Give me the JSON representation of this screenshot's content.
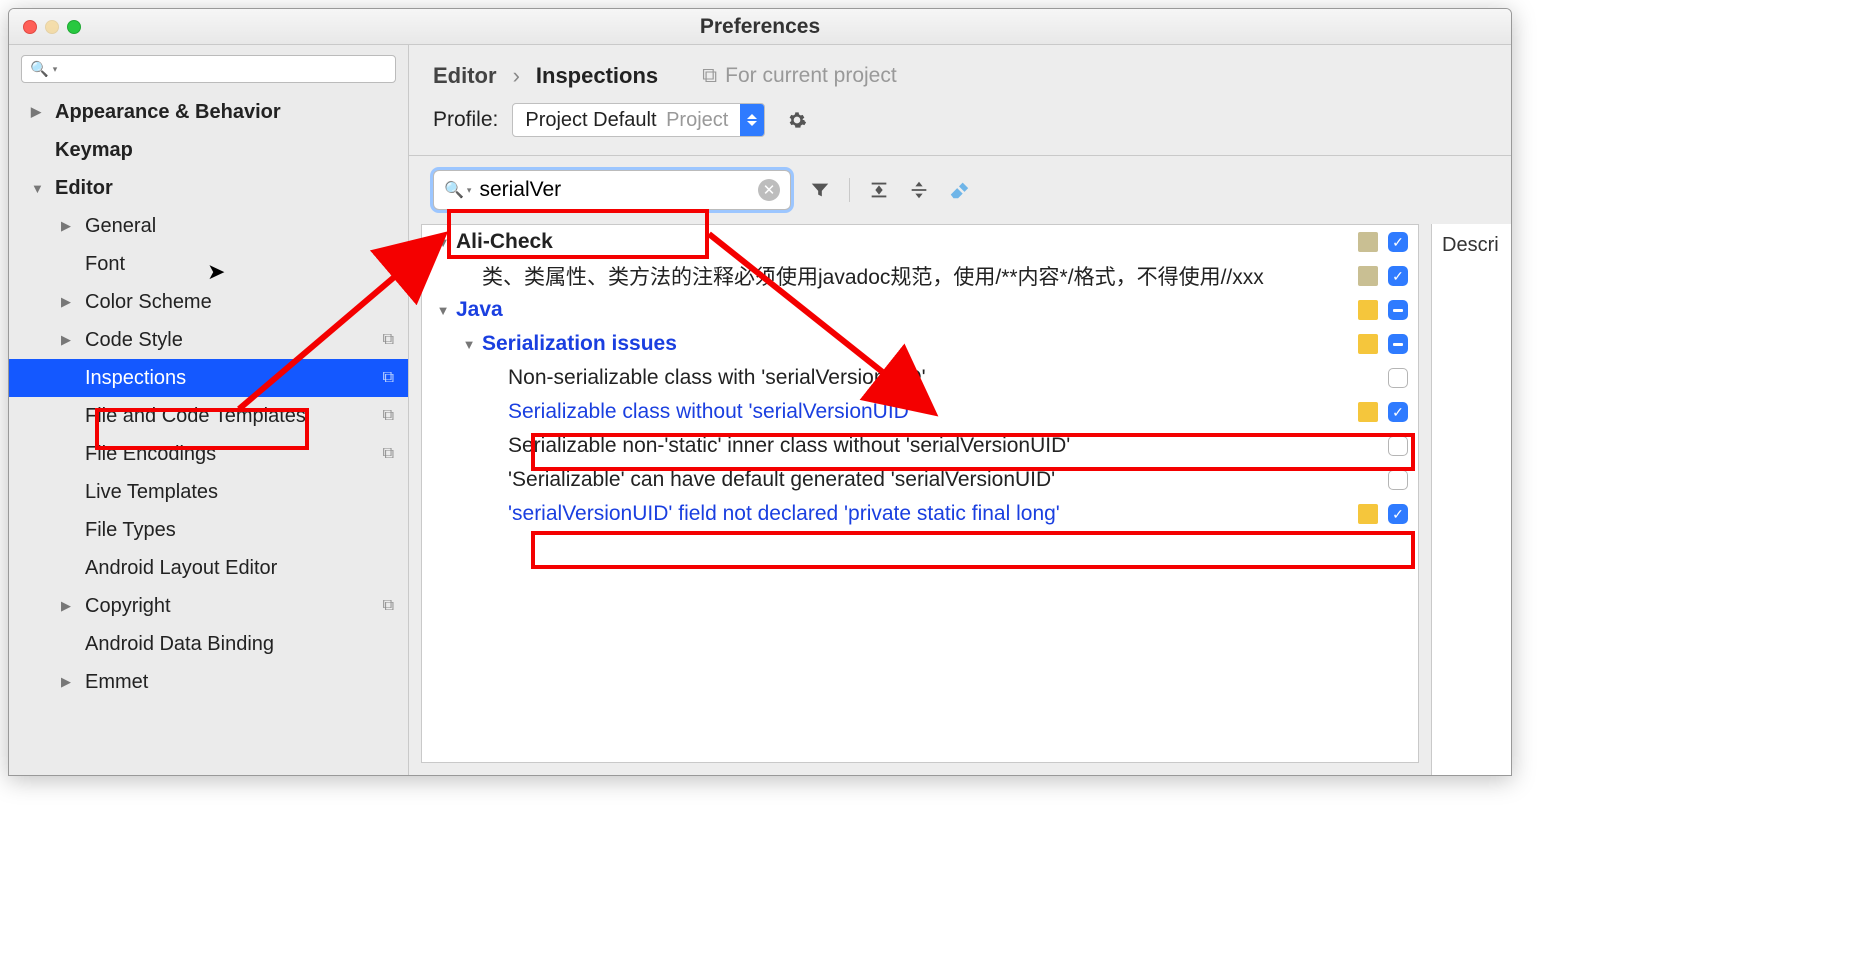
{
  "window_title": "Preferences",
  "sidebar": {
    "search_value": "",
    "items": [
      {
        "label": "Appearance & Behavior",
        "arrow": "right",
        "bold": true,
        "lvl": 0
      },
      {
        "label": "Keymap",
        "arrow": "",
        "bold": true,
        "lvl": 0
      },
      {
        "label": "Editor",
        "arrow": "down",
        "bold": true,
        "lvl": 0
      },
      {
        "label": "General",
        "arrow": "right",
        "bold": false,
        "lvl": 1
      },
      {
        "label": "Font",
        "arrow": "",
        "bold": false,
        "lvl": 1
      },
      {
        "label": "Color Scheme",
        "arrow": "right",
        "bold": false,
        "lvl": 1
      },
      {
        "label": "Code Style",
        "arrow": "right",
        "bold": false,
        "lvl": 1,
        "badge": true
      },
      {
        "label": "Inspections",
        "arrow": "",
        "bold": false,
        "lvl": 1,
        "badge": true,
        "selected": true
      },
      {
        "label": "File and Code Templates",
        "arrow": "",
        "bold": false,
        "lvl": 1,
        "badge": true
      },
      {
        "label": "File Encodings",
        "arrow": "",
        "bold": false,
        "lvl": 1,
        "badge": true
      },
      {
        "label": "Live Templates",
        "arrow": "",
        "bold": false,
        "lvl": 1
      },
      {
        "label": "File Types",
        "arrow": "",
        "bold": false,
        "lvl": 1
      },
      {
        "label": "Android Layout Editor",
        "arrow": "",
        "bold": false,
        "lvl": 1
      },
      {
        "label": "Copyright",
        "arrow": "right",
        "bold": false,
        "lvl": 1,
        "badge": true
      },
      {
        "label": "Android Data Binding",
        "arrow": "",
        "bold": false,
        "lvl": 1
      },
      {
        "label": "Emmet",
        "arrow": "right",
        "bold": false,
        "lvl": 1
      }
    ]
  },
  "breadcrumb": {
    "c1": "Editor",
    "c2": "Inspections",
    "scope": "For current project"
  },
  "profile": {
    "label": "Profile:",
    "name": "Project Default",
    "suffix": "Project"
  },
  "inspection_search": "serialVer",
  "rows": [
    {
      "indent": 0,
      "arrow": "down",
      "label": "Ali-Check",
      "bold": true,
      "sev": "tan",
      "cb": "checked"
    },
    {
      "indent": 1,
      "arrow": "",
      "label": "类、类属性、类方法的注释必须使用javadoc规范，使用/**内容*/格式，不得使用//xxx",
      "sev": "tan",
      "cb": "checked"
    },
    {
      "indent": 0,
      "arrow": "down",
      "label": "Java",
      "bold": true,
      "hl": true,
      "sev": "yellow",
      "cb": "mixed"
    },
    {
      "indent": 1,
      "arrow": "down",
      "label": "Serialization issues",
      "bold": true,
      "hl": true,
      "sev": "yellow",
      "cb": "mixed"
    },
    {
      "indent": 2,
      "arrow": "",
      "label": "Non-serializable class with 'serialVersionUID'",
      "cb": "unchecked"
    },
    {
      "indent": 2,
      "arrow": "",
      "label": "Serializable class without 'serialVersionUID'",
      "hl": true,
      "sev": "yellow",
      "cb": "checked"
    },
    {
      "indent": 2,
      "arrow": "",
      "label": "Serializable non-'static' inner class without 'serialVersionUID'",
      "cb": "unchecked"
    },
    {
      "indent": 2,
      "arrow": "",
      "label": "'Serializable' can have default generated 'serialVersionUID'",
      "cb": "unchecked"
    },
    {
      "indent": 2,
      "arrow": "",
      "label": "'serialVersionUID' field not declared 'private static final long'",
      "hl": true,
      "sev": "yellow",
      "cb": "checked"
    }
  ],
  "right_panel_header": "Descri"
}
